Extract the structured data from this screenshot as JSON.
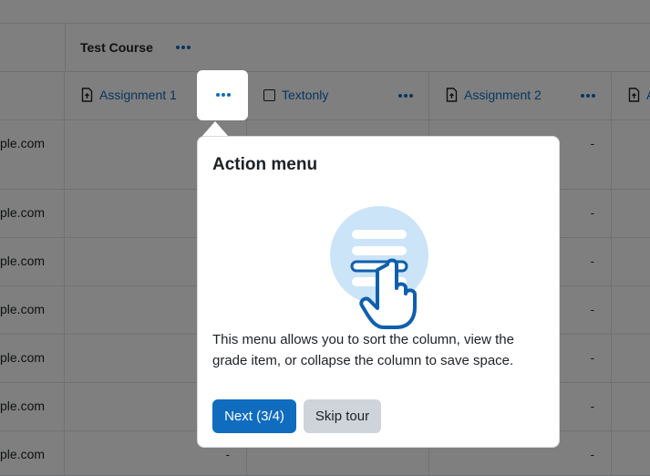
{
  "course": {
    "title": "Test Course"
  },
  "columns": [
    {
      "label": "Assignment 1",
      "icon": "assignment-icon"
    },
    {
      "label": "Textonly",
      "icon": "checkbox-icon"
    },
    {
      "label": "Assignment 2",
      "icon": "assignment-icon"
    },
    {
      "label": "A",
      "icon": "assignment-icon"
    }
  ],
  "rows": [
    {
      "email": "ple.com",
      "c1": "",
      "c3": "-"
    },
    {
      "email": "ple.com",
      "c1": "",
      "c3": "-"
    },
    {
      "email": "ple.com",
      "c1": "",
      "c3": "-"
    },
    {
      "email": "ple.com",
      "c1": "",
      "c3": "-"
    },
    {
      "email": "ple.com",
      "c1": "",
      "c3": "-"
    },
    {
      "email": "ple.com",
      "c1": "",
      "c3": "-"
    },
    {
      "email": "ple.com",
      "c1": "-",
      "c3": "-"
    }
  ],
  "tour": {
    "title": "Action menu",
    "body": "This menu allows you to sort the column, view the grade item, or collapse the column to save space.",
    "next_label": "Next (3/4)",
    "skip_label": "Skip tour"
  },
  "colors": {
    "accent": "#0f6cbf",
    "illustration_bg": "#cce4f8",
    "illustration_line": "#0f5fad"
  }
}
